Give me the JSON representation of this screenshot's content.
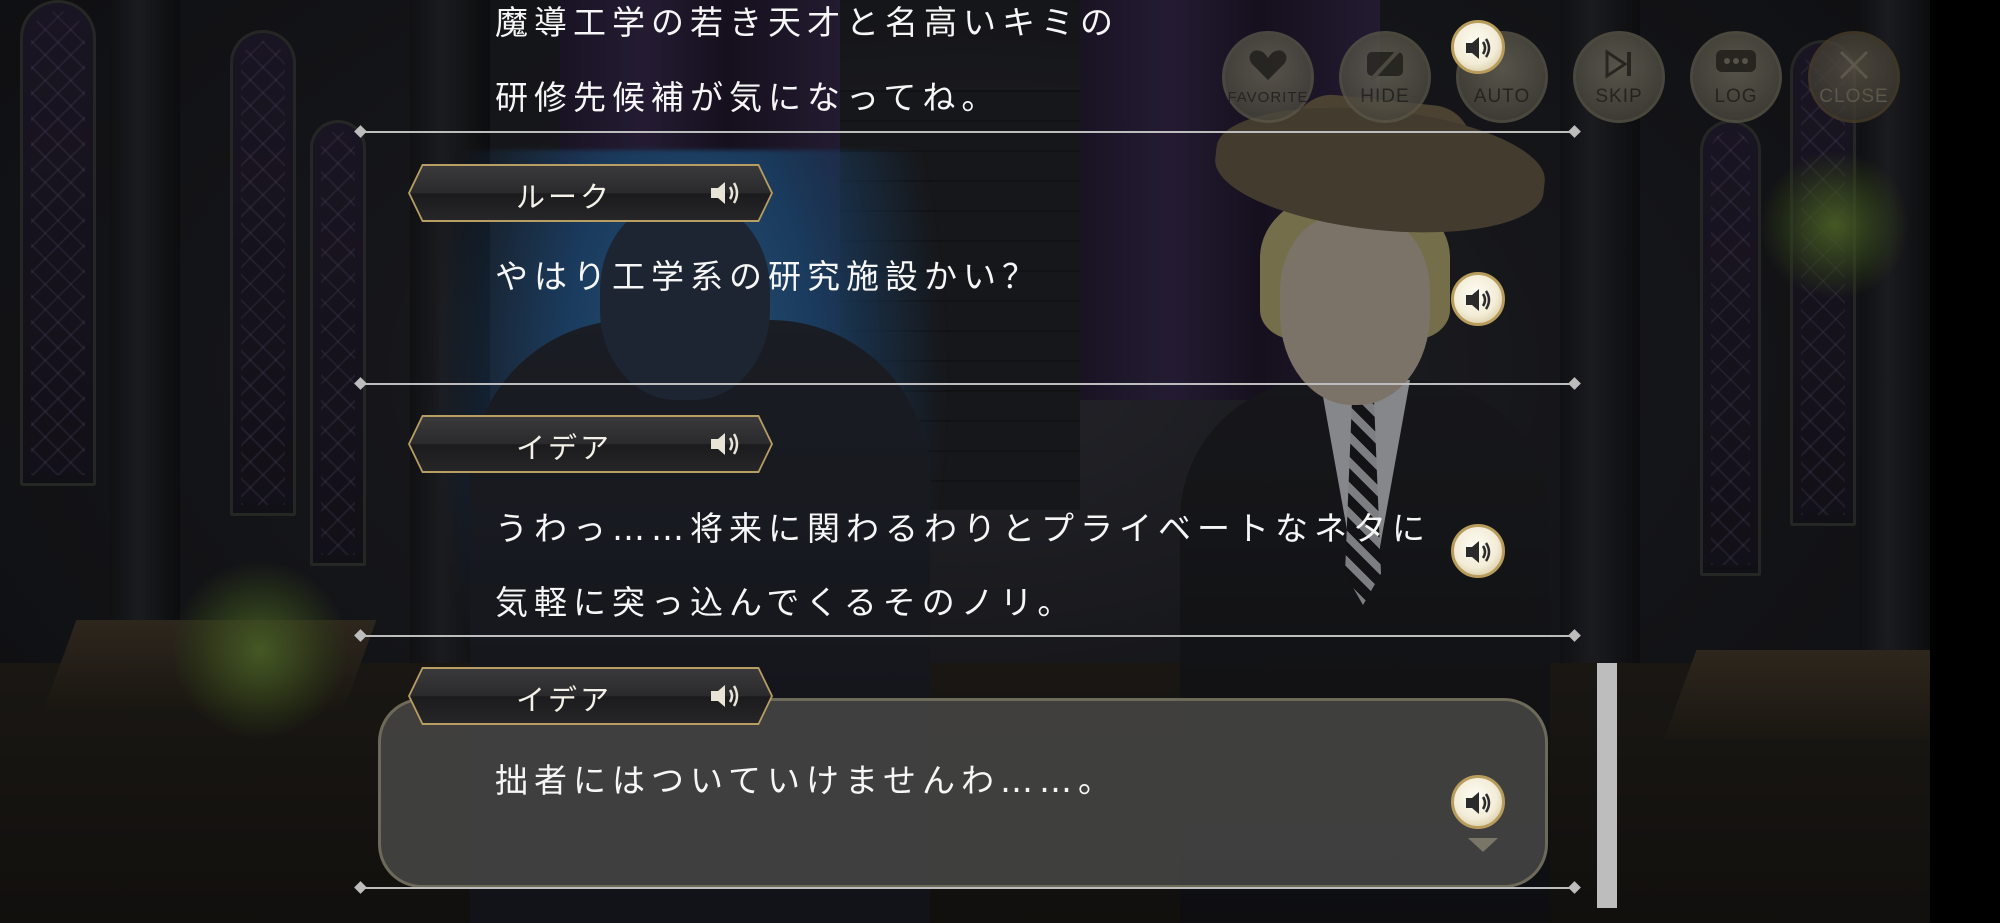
{
  "controls": {
    "favorite": "FAVORITE",
    "hide": "HIDE",
    "auto": "AUTO",
    "skip": "SKIP",
    "log": "LOG",
    "close": "CLOSE"
  },
  "log": {
    "entries": [
      {
        "speaker": "",
        "lines": [
          "魔導工学の若き天才と名高いキミの",
          "研修先候補が気になってね。"
        ]
      },
      {
        "speaker": "ルーク",
        "lines": [
          "やはり工学系の研究施設かい？"
        ]
      },
      {
        "speaker": "イデア",
        "lines": [
          "うわっ……将来に関わるわりとプライベートなネタに",
          "気軽に突っ込んでくるそのノリ。"
        ]
      },
      {
        "speaker": "イデア",
        "lines": [
          "拙者にはついていけませんわ……。"
        ]
      }
    ]
  },
  "colors": {
    "accent_gold": "#b89e62",
    "text": "#f6f6f6"
  },
  "icons": {
    "voice": "speaker-icon",
    "favorite": "heart-icon",
    "hide": "hide-icon",
    "skip": "skip-icon",
    "log": "chat-bubble-icon",
    "close": "close-icon"
  }
}
